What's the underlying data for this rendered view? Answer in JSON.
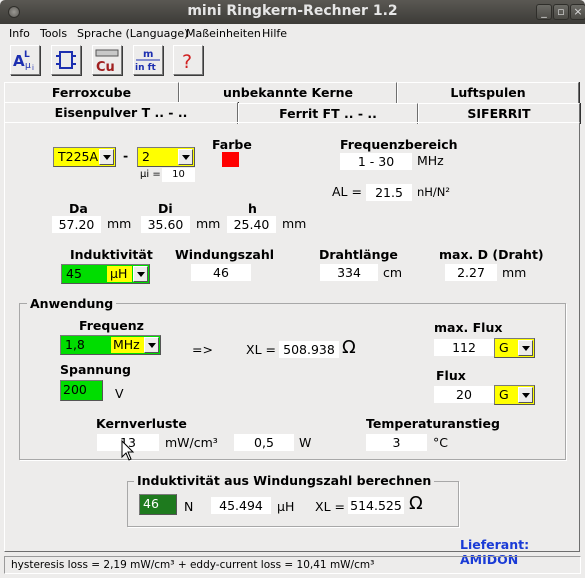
{
  "window": {
    "title": "mini Ringkern-Rechner 1.2",
    "min_glyph": "_",
    "max_glyph": "▫",
    "close_glyph": "×"
  },
  "menu": [
    "Info",
    "Tools",
    "Sprache (Language)",
    "Maßeinheiten",
    "Hilfe"
  ],
  "toolbar": {
    "al_button": {
      "top": "A",
      "mid": "L",
      "sub": "μ",
      "right": "i"
    },
    "cu_button": "Cu",
    "units_button": {
      "top": "m",
      "bottom": "in ft"
    },
    "help_button": "?"
  },
  "tabs": {
    "row1": [
      "Ferroxcube",
      "unbekannte Kerne",
      "Luftspulen"
    ],
    "row2": [
      "Eisenpulver T .. - ..",
      "Ferrit FT .. - ..",
      "SIFERRIT"
    ]
  },
  "core": {
    "type": "T225A",
    "separator": "-",
    "mix": "2",
    "mu_label": "µi =",
    "mu_value": "10",
    "farbe_label": "Farbe",
    "farbe_color": "#ff0000"
  },
  "freq_range": {
    "label": "Frequenzbereich",
    "value": "1 - 30",
    "unit": "MHz"
  },
  "al": {
    "label": "AL =",
    "value": "21.5",
    "unit": "nH/N²"
  },
  "dims": {
    "da_label": "Da",
    "da_value": "57.20",
    "da_unit": "mm",
    "di_label": "Di",
    "di_value": "35.60",
    "di_unit": "mm",
    "h_label": "h",
    "h_value": "25.40",
    "h_unit": "mm"
  },
  "induct": {
    "label": "Induktivität",
    "value": "45",
    "unit": "µH"
  },
  "windings": {
    "label": "Windungszahl",
    "value": "46"
  },
  "wire": {
    "label": "Drahtlänge",
    "value": "334",
    "unit": "cm"
  },
  "maxd": {
    "label": "max. D (Draht)",
    "value": "2.27",
    "unit": "mm"
  },
  "anwendung": {
    "title": "Anwendung",
    "freq_label": "Frequenz",
    "freq_value": "1,8",
    "freq_unit": "MHz",
    "arrow": "=>",
    "xl_label": "XL =",
    "xl_value": "508.938",
    "ohm": "Ω",
    "maxflux_label": "max. Flux",
    "maxflux_value": "112",
    "maxflux_unit": "G",
    "spannung_label": "Spannung",
    "spannung_value": "200",
    "spannung_unit": "V",
    "flux_label": "Flux",
    "flux_value": "20",
    "flux_unit": "G",
    "kern_label": "Kernverluste",
    "kern_value": "13",
    "kern_unit": "mW/cm³",
    "watt_value": "0,5",
    "watt_unit": "W",
    "temp_label": "Temperaturanstieg",
    "temp_value": "3",
    "temp_unit": "°C"
  },
  "calc": {
    "title": "Induktivität aus Windungszahl berechnen",
    "n_value": "46",
    "n_unit": "N",
    "ind_value": "45.494",
    "ind_unit": "µH",
    "xl_label": "XL =",
    "xl_value": "514.525",
    "ohm": "Ω"
  },
  "supplier": "Lieferant: AMIDON",
  "status": "hysteresis loss = 2,19 mW/cm³ +  eddy-current loss = 10,41 mW/cm³",
  "colors": {
    "green": "#00dd00",
    "yellow": "#ffff00",
    "dark_green": "#1e7a1e",
    "blue_text": "#1a3bd6"
  }
}
